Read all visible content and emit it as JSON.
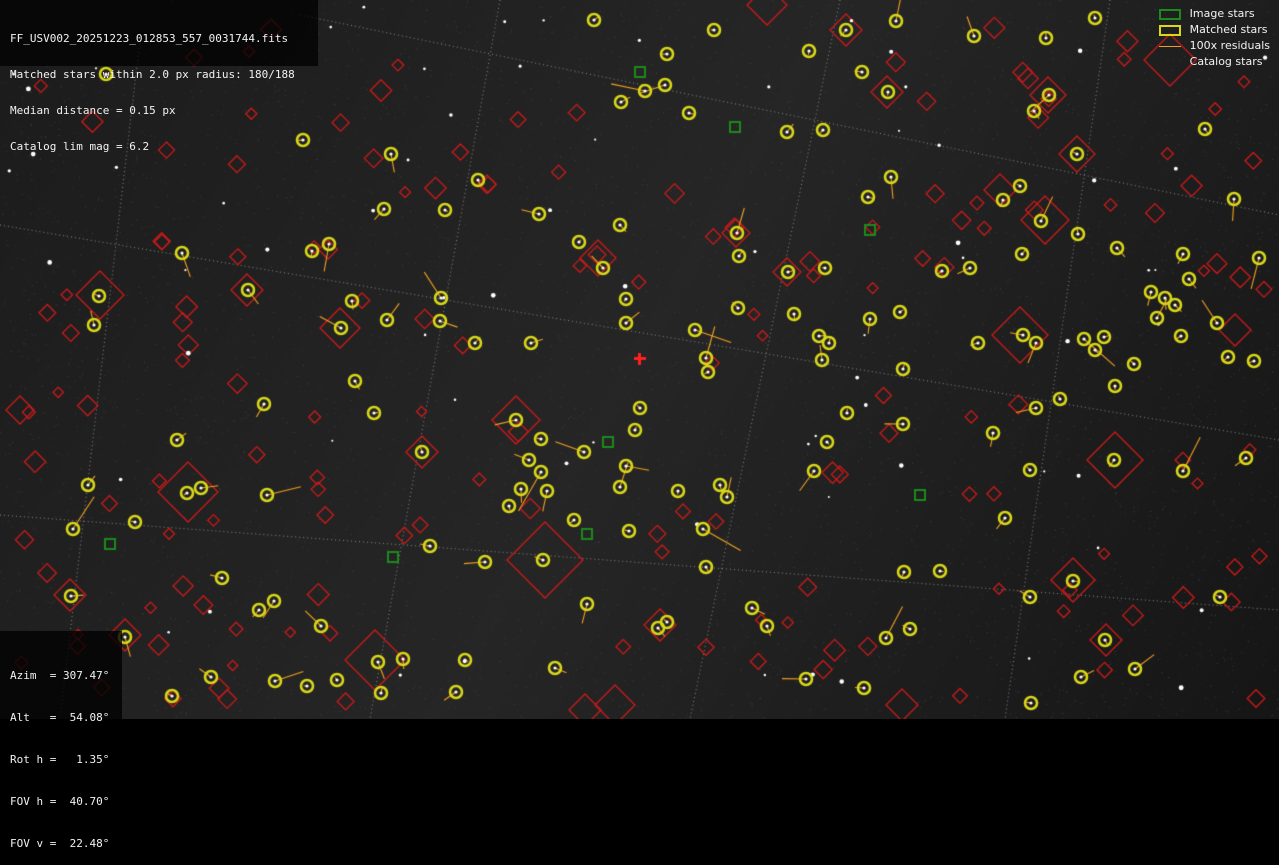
{
  "info": {
    "filename": "FF_USV002_20251223_012853_557_0031744.fits",
    "matched": "Matched stars within 2.0 px radius: 180/188",
    "median": "Median distance = 0.15 px",
    "catalog_lim": "Catalog lim mag = 6.2"
  },
  "legend": {
    "image_stars": "Image stars",
    "matched_stars": "Matched stars",
    "residuals": "100x residuals",
    "catalog_stars": "Catalog stars"
  },
  "pointing": {
    "azim": "Azim  = 307.47°",
    "alt": "Alt   =  54.08°",
    "rot": "Rot h =   1.35°",
    "fov_h": "FOV h =  40.70°",
    "fov_v": "FOV v =  22.48°"
  },
  "colors": {
    "background": "#000000",
    "image_star_box": "#1c8a1c",
    "matched_star_circle": "#d8d81a",
    "residual_line": "#f0a020",
    "catalog_star_diamond": "#cc1a1a",
    "grid_line": "#8a8a8a",
    "centre_marker": "#ff2020"
  },
  "markers": {
    "centre_marker": "red-cross-icon"
  }
}
